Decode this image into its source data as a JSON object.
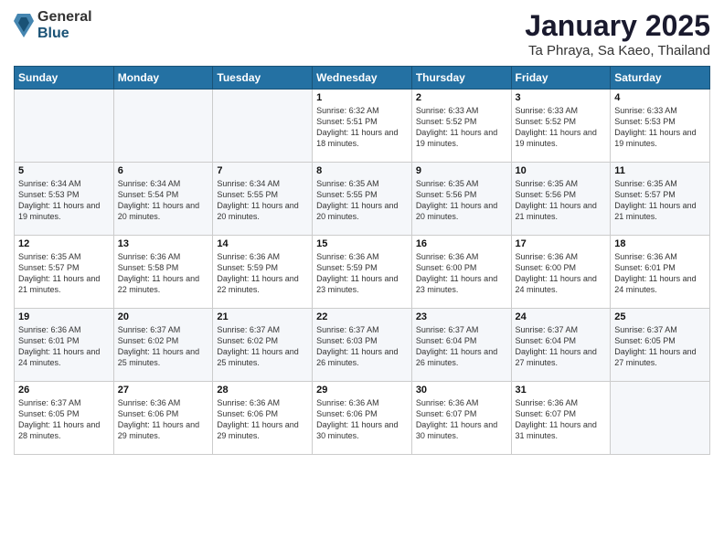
{
  "logo": {
    "general": "General",
    "blue": "Blue"
  },
  "header": {
    "month": "January 2025",
    "location": "Ta Phraya, Sa Kaeo, Thailand"
  },
  "weekdays": [
    "Sunday",
    "Monday",
    "Tuesday",
    "Wednesday",
    "Thursday",
    "Friday",
    "Saturday"
  ],
  "weeks": [
    [
      {
        "day": "",
        "sunrise": "",
        "sunset": "",
        "daylight": ""
      },
      {
        "day": "",
        "sunrise": "",
        "sunset": "",
        "daylight": ""
      },
      {
        "day": "",
        "sunrise": "",
        "sunset": "",
        "daylight": ""
      },
      {
        "day": "1",
        "sunrise": "Sunrise: 6:32 AM",
        "sunset": "Sunset: 5:51 PM",
        "daylight": "Daylight: 11 hours and 18 minutes."
      },
      {
        "day": "2",
        "sunrise": "Sunrise: 6:33 AM",
        "sunset": "Sunset: 5:52 PM",
        "daylight": "Daylight: 11 hours and 19 minutes."
      },
      {
        "day": "3",
        "sunrise": "Sunrise: 6:33 AM",
        "sunset": "Sunset: 5:52 PM",
        "daylight": "Daylight: 11 hours and 19 minutes."
      },
      {
        "day": "4",
        "sunrise": "Sunrise: 6:33 AM",
        "sunset": "Sunset: 5:53 PM",
        "daylight": "Daylight: 11 hours and 19 minutes."
      }
    ],
    [
      {
        "day": "5",
        "sunrise": "Sunrise: 6:34 AM",
        "sunset": "Sunset: 5:53 PM",
        "daylight": "Daylight: 11 hours and 19 minutes."
      },
      {
        "day": "6",
        "sunrise": "Sunrise: 6:34 AM",
        "sunset": "Sunset: 5:54 PM",
        "daylight": "Daylight: 11 hours and 20 minutes."
      },
      {
        "day": "7",
        "sunrise": "Sunrise: 6:34 AM",
        "sunset": "Sunset: 5:55 PM",
        "daylight": "Daylight: 11 hours and 20 minutes."
      },
      {
        "day": "8",
        "sunrise": "Sunrise: 6:35 AM",
        "sunset": "Sunset: 5:55 PM",
        "daylight": "Daylight: 11 hours and 20 minutes."
      },
      {
        "day": "9",
        "sunrise": "Sunrise: 6:35 AM",
        "sunset": "Sunset: 5:56 PM",
        "daylight": "Daylight: 11 hours and 20 minutes."
      },
      {
        "day": "10",
        "sunrise": "Sunrise: 6:35 AM",
        "sunset": "Sunset: 5:56 PM",
        "daylight": "Daylight: 11 hours and 21 minutes."
      },
      {
        "day": "11",
        "sunrise": "Sunrise: 6:35 AM",
        "sunset": "Sunset: 5:57 PM",
        "daylight": "Daylight: 11 hours and 21 minutes."
      }
    ],
    [
      {
        "day": "12",
        "sunrise": "Sunrise: 6:35 AM",
        "sunset": "Sunset: 5:57 PM",
        "daylight": "Daylight: 11 hours and 21 minutes."
      },
      {
        "day": "13",
        "sunrise": "Sunrise: 6:36 AM",
        "sunset": "Sunset: 5:58 PM",
        "daylight": "Daylight: 11 hours and 22 minutes."
      },
      {
        "day": "14",
        "sunrise": "Sunrise: 6:36 AM",
        "sunset": "Sunset: 5:59 PM",
        "daylight": "Daylight: 11 hours and 22 minutes."
      },
      {
        "day": "15",
        "sunrise": "Sunrise: 6:36 AM",
        "sunset": "Sunset: 5:59 PM",
        "daylight": "Daylight: 11 hours and 23 minutes."
      },
      {
        "day": "16",
        "sunrise": "Sunrise: 6:36 AM",
        "sunset": "Sunset: 6:00 PM",
        "daylight": "Daylight: 11 hours and 23 minutes."
      },
      {
        "day": "17",
        "sunrise": "Sunrise: 6:36 AM",
        "sunset": "Sunset: 6:00 PM",
        "daylight": "Daylight: 11 hours and 24 minutes."
      },
      {
        "day": "18",
        "sunrise": "Sunrise: 6:36 AM",
        "sunset": "Sunset: 6:01 PM",
        "daylight": "Daylight: 11 hours and 24 minutes."
      }
    ],
    [
      {
        "day": "19",
        "sunrise": "Sunrise: 6:36 AM",
        "sunset": "Sunset: 6:01 PM",
        "daylight": "Daylight: 11 hours and 24 minutes."
      },
      {
        "day": "20",
        "sunrise": "Sunrise: 6:37 AM",
        "sunset": "Sunset: 6:02 PM",
        "daylight": "Daylight: 11 hours and 25 minutes."
      },
      {
        "day": "21",
        "sunrise": "Sunrise: 6:37 AM",
        "sunset": "Sunset: 6:02 PM",
        "daylight": "Daylight: 11 hours and 25 minutes."
      },
      {
        "day": "22",
        "sunrise": "Sunrise: 6:37 AM",
        "sunset": "Sunset: 6:03 PM",
        "daylight": "Daylight: 11 hours and 26 minutes."
      },
      {
        "day": "23",
        "sunrise": "Sunrise: 6:37 AM",
        "sunset": "Sunset: 6:04 PM",
        "daylight": "Daylight: 11 hours and 26 minutes."
      },
      {
        "day": "24",
        "sunrise": "Sunrise: 6:37 AM",
        "sunset": "Sunset: 6:04 PM",
        "daylight": "Daylight: 11 hours and 27 minutes."
      },
      {
        "day": "25",
        "sunrise": "Sunrise: 6:37 AM",
        "sunset": "Sunset: 6:05 PM",
        "daylight": "Daylight: 11 hours and 27 minutes."
      }
    ],
    [
      {
        "day": "26",
        "sunrise": "Sunrise: 6:37 AM",
        "sunset": "Sunset: 6:05 PM",
        "daylight": "Daylight: 11 hours and 28 minutes."
      },
      {
        "day": "27",
        "sunrise": "Sunrise: 6:36 AM",
        "sunset": "Sunset: 6:06 PM",
        "daylight": "Daylight: 11 hours and 29 minutes."
      },
      {
        "day": "28",
        "sunrise": "Sunrise: 6:36 AM",
        "sunset": "Sunset: 6:06 PM",
        "daylight": "Daylight: 11 hours and 29 minutes."
      },
      {
        "day": "29",
        "sunrise": "Sunrise: 6:36 AM",
        "sunset": "Sunset: 6:06 PM",
        "daylight": "Daylight: 11 hours and 30 minutes."
      },
      {
        "day": "30",
        "sunrise": "Sunrise: 6:36 AM",
        "sunset": "Sunset: 6:07 PM",
        "daylight": "Daylight: 11 hours and 30 minutes."
      },
      {
        "day": "31",
        "sunrise": "Sunrise: 6:36 AM",
        "sunset": "Sunset: 6:07 PM",
        "daylight": "Daylight: 11 hours and 31 minutes."
      },
      {
        "day": "",
        "sunrise": "",
        "sunset": "",
        "daylight": ""
      }
    ]
  ]
}
